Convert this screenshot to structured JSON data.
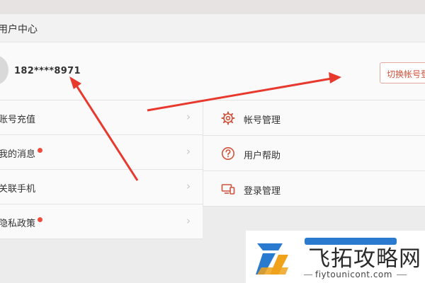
{
  "header": {
    "title": "用户中心"
  },
  "profile": {
    "phone": "182****8971",
    "switch_label": "切换帐号登录"
  },
  "left_menu": [
    {
      "label": "账号充值",
      "dot": false
    },
    {
      "label": "我的消息",
      "dot": true
    },
    {
      "label": "关联手机",
      "dot": false
    },
    {
      "label": "隐私政策",
      "dot": true
    }
  ],
  "right_menu": [
    {
      "label": "帐号管理",
      "icon": "gear-icon"
    },
    {
      "label": "用户帮助",
      "icon": "question-icon"
    },
    {
      "label": "登录管理",
      "icon": "devices-icon"
    }
  ],
  "colors": {
    "accent": "#d0523a",
    "dot": "#ee4d3c",
    "arrow": "#e8392f",
    "watermark_blue": "#2a7bd0"
  },
  "watermark": {
    "brand": "飞拓攻略网",
    "url": "fiytounicont.com"
  }
}
